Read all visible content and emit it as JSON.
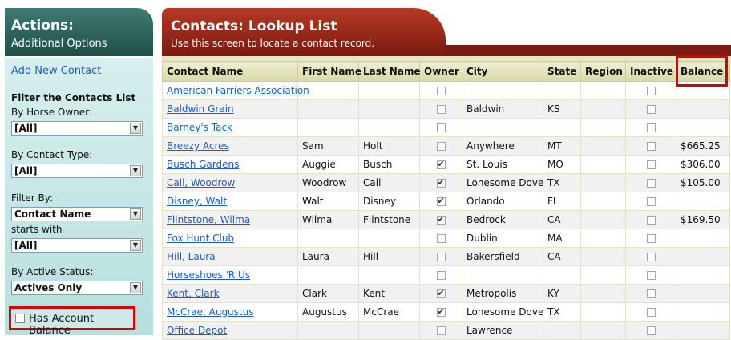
{
  "sidebar": {
    "title": "Actions:",
    "subtitle": "Additional Options",
    "add_link": "Add New Contact",
    "filter_heading": "Filter the Contacts List",
    "horse_owner_label": "By Horse Owner:",
    "horse_owner_value": "[All]",
    "contact_type_label": "By Contact Type:",
    "contact_type_value": "[All]",
    "filter_by_label": "Filter By:",
    "filter_by_value": "Contact Name",
    "starts_with_label": "starts with",
    "starts_with_value": "[All]",
    "active_status_label": "By Active Status:",
    "active_status_value": "Actives Only",
    "has_balance_label": "Has Account Balance",
    "has_balance_checked": false
  },
  "main": {
    "title": "Contacts: Lookup List",
    "subtitle": "Use this screen to locate a contact record.",
    "columns": [
      "Contact Name",
      "First Name",
      "Last Name",
      "Owner",
      "City",
      "State",
      "Region",
      "Inactive",
      "Balance"
    ],
    "rows": [
      {
        "name": "American Farriers Association",
        "first": "",
        "last": "",
        "owner": false,
        "city": "",
        "state": "",
        "region": "",
        "inactive": false,
        "balance": ""
      },
      {
        "name": "Baldwin Grain",
        "first": "",
        "last": "",
        "owner": false,
        "city": "Baldwin",
        "state": "KS",
        "region": "",
        "inactive": false,
        "balance": ""
      },
      {
        "name": "Barney's Tack",
        "first": "",
        "last": "",
        "owner": false,
        "city": "",
        "state": "",
        "region": "",
        "inactive": false,
        "balance": ""
      },
      {
        "name": "Breezy Acres",
        "first": "Sam",
        "last": "Holt",
        "owner": false,
        "city": "Anywhere",
        "state": "MT",
        "region": "",
        "inactive": false,
        "balance": "$665.25"
      },
      {
        "name": "Busch Gardens",
        "first": "Auggie",
        "last": "Busch",
        "owner": true,
        "city": "St. Louis",
        "state": "MO",
        "region": "",
        "inactive": false,
        "balance": "$306.00"
      },
      {
        "name": "Call, Woodrow",
        "first": "Woodrow",
        "last": "Call",
        "owner": true,
        "city": "Lonesome Dove",
        "state": "TX",
        "region": "",
        "inactive": false,
        "balance": "$105.00"
      },
      {
        "name": "Disney, Walt",
        "first": "Walt",
        "last": "Disney",
        "owner": true,
        "city": "Orlando",
        "state": "FL",
        "region": "",
        "inactive": false,
        "balance": ""
      },
      {
        "name": "Flintstone, Wilma",
        "first": "Wilma",
        "last": "Flintstone",
        "owner": true,
        "city": "Bedrock",
        "state": "CA",
        "region": "",
        "inactive": false,
        "balance": "$169.50"
      },
      {
        "name": "Fox Hunt Club",
        "first": "",
        "last": "",
        "owner": false,
        "city": "Dublin",
        "state": "MA",
        "region": "",
        "inactive": false,
        "balance": ""
      },
      {
        "name": "Hill, Laura",
        "first": "Laura",
        "last": "Hill",
        "owner": false,
        "city": "Bakersfield",
        "state": "CA",
        "region": "",
        "inactive": false,
        "balance": ""
      },
      {
        "name": "Horseshoes 'R Us",
        "first": "",
        "last": "",
        "owner": false,
        "city": "",
        "state": "",
        "region": "",
        "inactive": false,
        "balance": ""
      },
      {
        "name": "Kent, Clark",
        "first": "Clark",
        "last": "Kent",
        "owner": true,
        "city": "Metropolis",
        "state": "KY",
        "region": "",
        "inactive": false,
        "balance": ""
      },
      {
        "name": "McCrae, Augustus",
        "first": "Augustus",
        "last": "McCrae",
        "owner": true,
        "city": "Lonesome Dove",
        "state": "TX",
        "region": "",
        "inactive": false,
        "balance": ""
      },
      {
        "name": "Office Depot",
        "first": "",
        "last": "",
        "owner": false,
        "city": "Lawrence",
        "state": "",
        "region": "",
        "inactive": false,
        "balance": ""
      }
    ]
  },
  "colors": {
    "sidebar_header": "#1f4f48",
    "sidebar_body": "#c6e6e4",
    "main_header": "#9b2a1a",
    "link": "#1a5bd0",
    "highlight": "#dd0000"
  }
}
